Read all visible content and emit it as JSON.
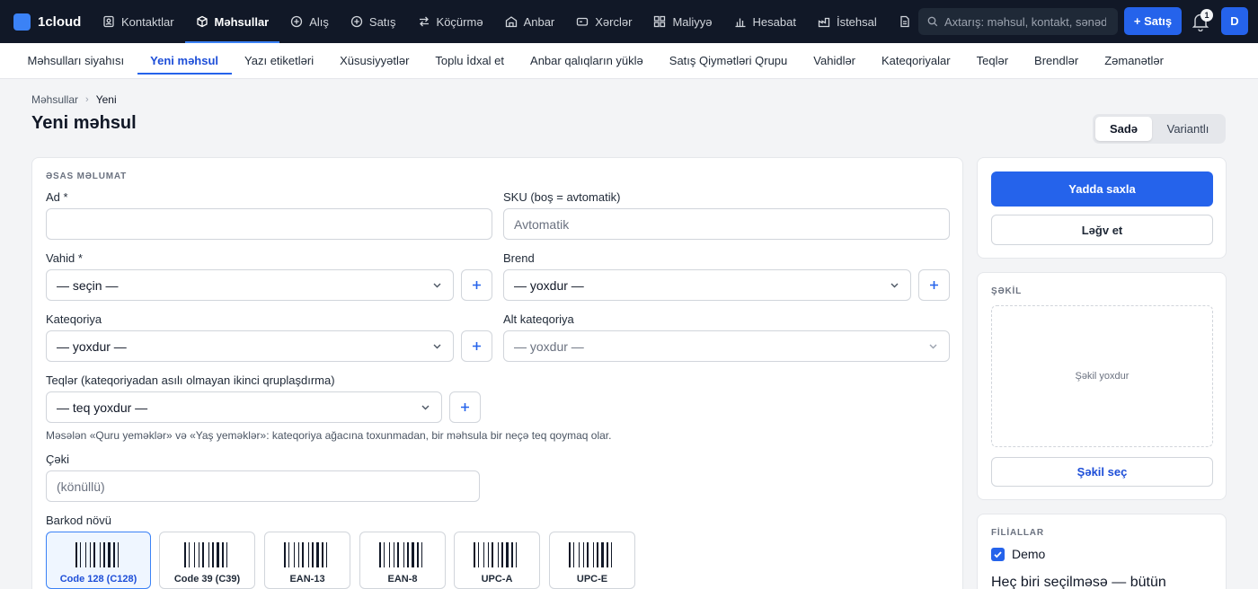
{
  "app": {
    "name": "1cloud"
  },
  "nav": {
    "items": [
      {
        "label": "Kontaktlar",
        "icon": "contacts-icon",
        "active": false
      },
      {
        "label": "Məhsullar",
        "icon": "box-icon",
        "active": true
      },
      {
        "label": "Alış",
        "icon": "plus-circle-icon",
        "active": false
      },
      {
        "label": "Satış",
        "icon": "plus-circle-icon",
        "active": false
      },
      {
        "label": "Köçürmə",
        "icon": "transfer-icon",
        "active": false
      },
      {
        "label": "Anbar",
        "icon": "warehouse-icon",
        "active": false
      },
      {
        "label": "Xərclər",
        "icon": "wallet-icon",
        "active": false
      },
      {
        "label": "Maliyyə",
        "icon": "grid-icon",
        "active": false
      },
      {
        "label": "Hesabat",
        "icon": "bar-chart-icon",
        "active": false
      },
      {
        "label": "İstehsal",
        "icon": "factory-icon",
        "active": false
      }
    ],
    "search_placeholder": "Axtarış: məhsul, kontakt, sənəd...",
    "sale_button": "+ Satış",
    "notification_count": "1",
    "avatar_initial": "D"
  },
  "subnav": {
    "items": [
      {
        "label": "Məhsulları siyahısı",
        "active": false
      },
      {
        "label": "Yeni məhsul",
        "active": true
      },
      {
        "label": "Yazı etiketləri",
        "active": false
      },
      {
        "label": "Xüsusiyyətlər",
        "active": false
      },
      {
        "label": "Toplu İdxal et",
        "active": false
      },
      {
        "label": "Anbar qalıqların yüklə",
        "active": false
      },
      {
        "label": "Satış Qiymətləri Qrupu",
        "active": false
      },
      {
        "label": "Vahidlər",
        "active": false
      },
      {
        "label": "Kateqoriyalar",
        "active": false
      },
      {
        "label": "Teqlər",
        "active": false
      },
      {
        "label": "Brendlər",
        "active": false
      },
      {
        "label": "Zəmanətlər",
        "active": false
      }
    ]
  },
  "breadcrumb": {
    "parent": "Məhsullar",
    "separator": "›",
    "current": "Yeni"
  },
  "page": {
    "title": "Yeni məhsul"
  },
  "mode_toggle": {
    "simple": "Sadə",
    "variant": "Variantlı",
    "selected": "Sadə"
  },
  "form": {
    "section_title": "ƏSAS MƏLUMAT",
    "name": {
      "label": "Ad *",
      "value": ""
    },
    "sku": {
      "label": "SKU (boş = avtomatik)",
      "placeholder": "Avtomatik"
    },
    "unit": {
      "label": "Vahid *",
      "value": "— seçin —"
    },
    "brand": {
      "label": "Brend",
      "value": "— yoxdur —"
    },
    "category": {
      "label": "Kateqoriya",
      "value": "— yoxdur —"
    },
    "subcategory": {
      "label": "Alt kateqoriya",
      "value": "— yoxdur —"
    },
    "tags": {
      "label": "Teqlər (kateqoriyadan asılı olmayan ikinci qruplaşdırma)",
      "value": "— teq yoxdur —",
      "hint": "Məsələn «Quru yeməklər» və «Yaş yeməklər»: kateqoriya ağacına toxunmadan, bir məhsula bir neçə teq qoymaq olar."
    },
    "weight": {
      "label": "Çəki",
      "placeholder": "(könüllü)"
    },
    "barcode": {
      "label": "Barkod növü",
      "options": [
        {
          "name": "Code 128 (C128)",
          "selected": true
        },
        {
          "name": "Code 39 (C39)",
          "selected": false
        },
        {
          "name": "EAN-13",
          "selected": false
        },
        {
          "name": "EAN-8",
          "selected": false
        },
        {
          "name": "UPC-A",
          "selected": false
        },
        {
          "name": "UPC-E",
          "selected": false
        }
      ]
    }
  },
  "actions": {
    "save": "Yadda saxla",
    "cancel": "Ləğv et"
  },
  "image": {
    "section_title": "ŞƏKİL",
    "empty_text": "Şəkil yoxdur",
    "choose_button": "Şəkil seç"
  },
  "branches": {
    "section_title": "FİLİALLAR",
    "items": [
      {
        "label": "Demo",
        "checked": true
      }
    ],
    "note": "Heç biri seçilməsə — bütün"
  },
  "colors": {
    "primary": "#2563eb",
    "topbar": "#111827",
    "accent": "#3b82f6"
  }
}
